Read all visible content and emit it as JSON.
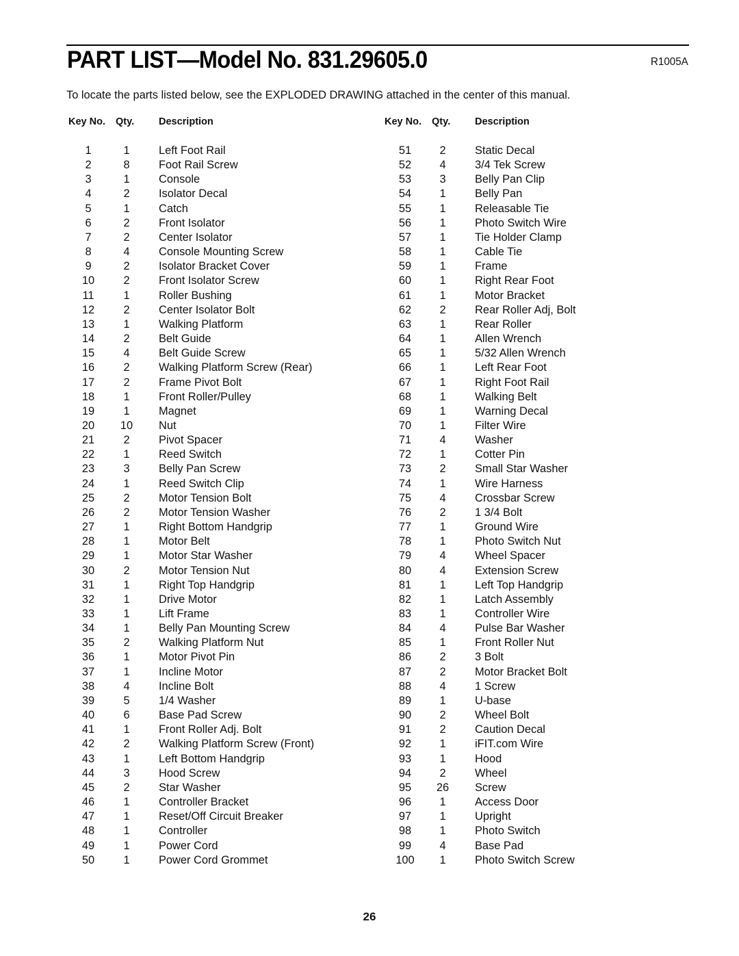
{
  "header": {
    "title": "PART LIST—Model No. 831.29605.0",
    "code": "R1005A"
  },
  "intro": "To locate the parts listed below, see the EXPLODED DRAWING attached in the center of this manual.",
  "columns": {
    "key": "Key No.",
    "qty": "Qty.",
    "description": "Description"
  },
  "parts_left": [
    {
      "key": "1",
      "qty": "1",
      "desc": "Left Foot Rail"
    },
    {
      "key": "2",
      "qty": "8",
      "desc": "Foot Rail Screw"
    },
    {
      "key": "3",
      "qty": "1",
      "desc": "Console"
    },
    {
      "key": "4",
      "qty": "2",
      "desc": "Isolator Decal"
    },
    {
      "key": "5",
      "qty": "1",
      "desc": "Catch"
    },
    {
      "key": "6",
      "qty": "2",
      "desc": "Front Isolator"
    },
    {
      "key": "7",
      "qty": "2",
      "desc": "Center Isolator"
    },
    {
      "key": "8",
      "qty": "4",
      "desc": "Console Mounting Screw"
    },
    {
      "key": "9",
      "qty": "2",
      "desc": "Isolator Bracket Cover"
    },
    {
      "key": "10",
      "qty": "2",
      "desc": "Front Isolator Screw"
    },
    {
      "key": "11",
      "qty": "1",
      "desc": "Roller Bushing"
    },
    {
      "key": "12",
      "qty": "2",
      "desc": "Center Isolator Bolt"
    },
    {
      "key": "13",
      "qty": "1",
      "desc": "Walking Platform"
    },
    {
      "key": "14",
      "qty": "2",
      "desc": "Belt Guide"
    },
    {
      "key": "15",
      "qty": "4",
      "desc": "Belt Guide Screw"
    },
    {
      "key": "16",
      "qty": "2",
      "desc": "Walking Platform Screw (Rear)"
    },
    {
      "key": "17",
      "qty": "2",
      "desc": "Frame Pivot Bolt"
    },
    {
      "key": "18",
      "qty": "1",
      "desc": "Front Roller/Pulley"
    },
    {
      "key": "19",
      "qty": "1",
      "desc": "Magnet"
    },
    {
      "key": "20",
      "qty": "10",
      "desc": "Nut"
    },
    {
      "key": "21",
      "qty": "2",
      "desc": "Pivot Spacer"
    },
    {
      "key": "22",
      "qty": "1",
      "desc": "Reed Switch"
    },
    {
      "key": "23",
      "qty": "3",
      "desc": "Belly Pan Screw"
    },
    {
      "key": "24",
      "qty": "1",
      "desc": "Reed Switch Clip"
    },
    {
      "key": "25",
      "qty": "2",
      "desc": "Motor Tension Bolt"
    },
    {
      "key": "26",
      "qty": "2",
      "desc": "Motor Tension Washer"
    },
    {
      "key": "27",
      "qty": "1",
      "desc": "Right Bottom Handgrip"
    },
    {
      "key": "28",
      "qty": "1",
      "desc": "Motor Belt"
    },
    {
      "key": "29",
      "qty": "1",
      "desc": "Motor Star Washer"
    },
    {
      "key": "30",
      "qty": "2",
      "desc": "Motor Tension Nut"
    },
    {
      "key": "31",
      "qty": "1",
      "desc": "Right Top Handgrip"
    },
    {
      "key": "32",
      "qty": "1",
      "desc": "Drive Motor"
    },
    {
      "key": "33",
      "qty": "1",
      "desc": "Lift Frame"
    },
    {
      "key": "34",
      "qty": "1",
      "desc": "Belly Pan Mounting Screw"
    },
    {
      "key": "35",
      "qty": "2",
      "desc": "Walking Platform Nut"
    },
    {
      "key": "36",
      "qty": "1",
      "desc": "Motor Pivot Pin"
    },
    {
      "key": "37",
      "qty": "1",
      "desc": "Incline Motor"
    },
    {
      "key": "38",
      "qty": "4",
      "desc": "Incline Bolt"
    },
    {
      "key": "39",
      "qty": "5",
      "desc": "1/4  Washer"
    },
    {
      "key": "40",
      "qty": "6",
      "desc": "Base Pad Screw"
    },
    {
      "key": "41",
      "qty": "1",
      "desc": "Front Roller Adj. Bolt"
    },
    {
      "key": "42",
      "qty": "2",
      "desc": "Walking Platform Screw (Front)"
    },
    {
      "key": "43",
      "qty": "1",
      "desc": "Left Bottom Handgrip"
    },
    {
      "key": "44",
      "qty": "3",
      "desc": "Hood Screw"
    },
    {
      "key": "45",
      "qty": "2",
      "desc": "Star Washer"
    },
    {
      "key": "46",
      "qty": "1",
      "desc": "Controller Bracket"
    },
    {
      "key": "47",
      "qty": "1",
      "desc": "Reset/Off Circuit Breaker"
    },
    {
      "key": "48",
      "qty": "1",
      "desc": "Controller"
    },
    {
      "key": "49",
      "qty": "1",
      "desc": "Power Cord"
    },
    {
      "key": "50",
      "qty": "1",
      "desc": "Power Cord Grommet"
    }
  ],
  "parts_right": [
    {
      "key": "51",
      "qty": "2",
      "desc": "Static Decal"
    },
    {
      "key": "52",
      "qty": "4",
      "desc": "3/4  Tek Screw"
    },
    {
      "key": "53",
      "qty": "3",
      "desc": "Belly Pan Clip"
    },
    {
      "key": "54",
      "qty": "1",
      "desc": "Belly Pan"
    },
    {
      "key": "55",
      "qty": "1",
      "desc": "Releasable Tie"
    },
    {
      "key": "56",
      "qty": "1",
      "desc": "Photo Switch Wire"
    },
    {
      "key": "57",
      "qty": "1",
      "desc": "Tie Holder Clamp"
    },
    {
      "key": "58",
      "qty": "1",
      "desc": "Cable Tie"
    },
    {
      "key": "59",
      "qty": "1",
      "desc": "Frame"
    },
    {
      "key": "60",
      "qty": "1",
      "desc": "Right Rear Foot"
    },
    {
      "key": "61",
      "qty": "1",
      "desc": "Motor Bracket"
    },
    {
      "key": "62",
      "qty": "2",
      "desc": "Rear Roller Adj, Bolt"
    },
    {
      "key": "63",
      "qty": "1",
      "desc": "Rear Roller"
    },
    {
      "key": "64",
      "qty": "1",
      "desc": "Allen Wrench"
    },
    {
      "key": "65",
      "qty": "1",
      "desc": "5/32  Allen Wrench"
    },
    {
      "key": "66",
      "qty": "1",
      "desc": "Left Rear Foot"
    },
    {
      "key": "67",
      "qty": "1",
      "desc": "Right Foot Rail"
    },
    {
      "key": "68",
      "qty": "1",
      "desc": "Walking Belt"
    },
    {
      "key": "69",
      "qty": "1",
      "desc": "Warning Decal"
    },
    {
      "key": "70",
      "qty": "1",
      "desc": "Filter Wire"
    },
    {
      "key": "71",
      "qty": "4",
      "desc": "Washer"
    },
    {
      "key": "72",
      "qty": "1",
      "desc": "Cotter Pin"
    },
    {
      "key": "73",
      "qty": "2",
      "desc": "Small Star Washer"
    },
    {
      "key": "74",
      "qty": "1",
      "desc": "Wire Harness"
    },
    {
      "key": "75",
      "qty": "4",
      "desc": "Crossbar Screw"
    },
    {
      "key": "76",
      "qty": "2",
      "desc": "1 3/4  Bolt"
    },
    {
      "key": "77",
      "qty": "1",
      "desc": "Ground Wire"
    },
    {
      "key": "78",
      "qty": "1",
      "desc": "Photo Switch Nut"
    },
    {
      "key": "79",
      "qty": "4",
      "desc": "Wheel Spacer"
    },
    {
      "key": "80",
      "qty": "4",
      "desc": "Extension Screw"
    },
    {
      "key": "81",
      "qty": "1",
      "desc": "Left Top Handgrip"
    },
    {
      "key": "82",
      "qty": "1",
      "desc": "Latch Assembly"
    },
    {
      "key": "83",
      "qty": "1",
      "desc": "Controller Wire"
    },
    {
      "key": "84",
      "qty": "4",
      "desc": "Pulse Bar Washer"
    },
    {
      "key": "85",
      "qty": "1",
      "desc": "Front Roller Nut"
    },
    {
      "key": "86",
      "qty": "2",
      "desc": "3  Bolt"
    },
    {
      "key": "87",
      "qty": "2",
      "desc": "Motor Bracket Bolt"
    },
    {
      "key": "88",
      "qty": "4",
      "desc": "1  Screw"
    },
    {
      "key": "89",
      "qty": "1",
      "desc": "U-base"
    },
    {
      "key": "90",
      "qty": "2",
      "desc": "Wheel Bolt"
    },
    {
      "key": "91",
      "qty": "2",
      "desc": "Caution Decal"
    },
    {
      "key": "92",
      "qty": "1",
      "desc": "iFIT.com Wire"
    },
    {
      "key": "93",
      "qty": "1",
      "desc": "Hood"
    },
    {
      "key": "94",
      "qty": "2",
      "desc": "Wheel"
    },
    {
      "key": "95",
      "qty": "26",
      "desc": "Screw"
    },
    {
      "key": "96",
      "qty": "1",
      "desc": "Access Door"
    },
    {
      "key": "97",
      "qty": "1",
      "desc": "Upright"
    },
    {
      "key": "98",
      "qty": "1",
      "desc": "Photo Switch"
    },
    {
      "key": "99",
      "qty": "4",
      "desc": "Base Pad"
    },
    {
      "key": "100",
      "qty": "1",
      "desc": "Photo Switch Screw"
    }
  ],
  "page_number": "26"
}
